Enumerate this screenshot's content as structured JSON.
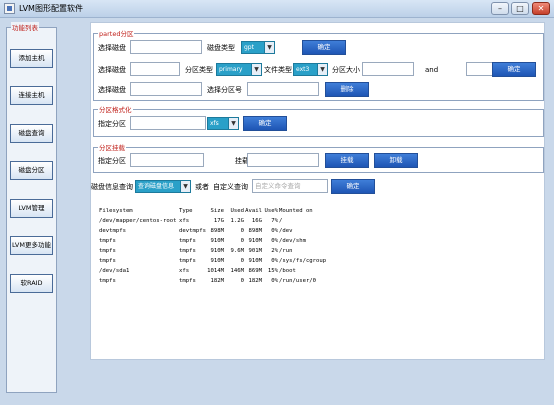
{
  "window": {
    "title": "LVM图形配置软件"
  },
  "sidebar": {
    "caption": "功能列表",
    "items": [
      {
        "label": "添加主机"
      },
      {
        "label": "连接主机"
      },
      {
        "label": "磁盘查询"
      },
      {
        "label": "磁盘分区"
      },
      {
        "label": "LVM管理"
      },
      {
        "label": "LVM更多功能"
      },
      {
        "label": "软RAID"
      }
    ]
  },
  "parted": {
    "caption": "parted分区",
    "row1": {
      "disk_label": "选择磁盘",
      "disktype_label": "磁盘类型",
      "disktype_value": "gpt",
      "confirm": "确定"
    },
    "row2": {
      "disk_label": "选择磁盘",
      "parttype_label": "分区类型",
      "parttype_value": "primary",
      "fstype_label": "文件类型",
      "fstype_value": "ext3",
      "size_label": "分区大小",
      "and_label": "and",
      "confirm": "确定"
    },
    "row3": {
      "disk_label": "选择磁盘",
      "partnum_label": "选择分区号",
      "delete": "删除"
    }
  },
  "format": {
    "caption": "分区格式化",
    "part_label": "指定分区",
    "fs_value": "xfs",
    "confirm": "确定"
  },
  "mount": {
    "caption": "分区挂载",
    "part_label": "指定分区",
    "dir_label": "挂载的目录",
    "mount_btn": "挂载",
    "umount_btn": "卸载"
  },
  "query": {
    "label": "磁盘信息查询",
    "combo_value": "查询磁盘信息",
    "or_label": "或者",
    "custom_label": "自定义查询",
    "custom_placeholder": "自定义命令查询",
    "confirm": "确定"
  },
  "df_output": {
    "headers": [
      "Filesystem",
      "Type",
      "Size",
      "Used",
      "Avail",
      "Use%",
      "Mounted on"
    ],
    "rows": [
      [
        "/dev/mapper/centos-root",
        "xfs",
        "17G",
        "1.2G",
        "16G",
        "7%",
        "/"
      ],
      [
        "devtmpfs",
        "devtmpfs",
        "898M",
        "0",
        "898M",
        "0%",
        "/dev"
      ],
      [
        "tmpfs",
        "tmpfs",
        "910M",
        "0",
        "910M",
        "0%",
        "/dev/shm"
      ],
      [
        "tmpfs",
        "tmpfs",
        "910M",
        "9.6M",
        "901M",
        "2%",
        "/run"
      ],
      [
        "tmpfs",
        "tmpfs",
        "910M",
        "0",
        "910M",
        "0%",
        "/sys/fs/cgroup"
      ],
      [
        "/dev/sda1",
        "xfs",
        "1014M",
        "146M",
        "869M",
        "15%",
        "/boot"
      ],
      [
        "tmpfs",
        "tmpfs",
        "182M",
        "0",
        "182M",
        "0%",
        "/run/user/0"
      ]
    ]
  }
}
